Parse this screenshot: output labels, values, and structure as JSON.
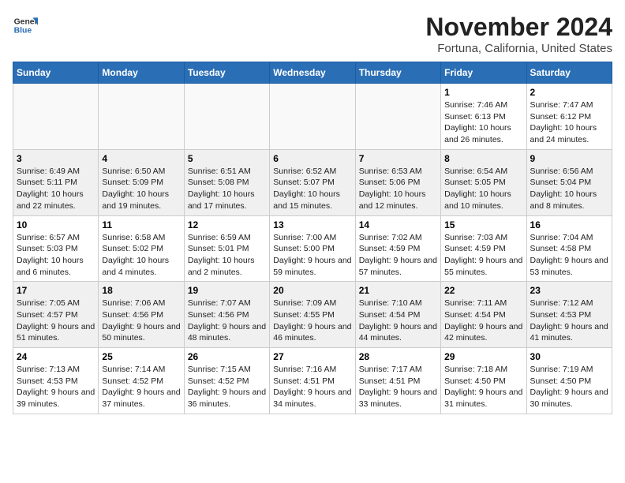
{
  "logo": {
    "general": "General",
    "blue": "Blue"
  },
  "header": {
    "month": "November 2024",
    "location": "Fortuna, California, United States"
  },
  "weekdays": [
    "Sunday",
    "Monday",
    "Tuesday",
    "Wednesday",
    "Thursday",
    "Friday",
    "Saturday"
  ],
  "weeks": [
    [
      {
        "day": "",
        "empty": true
      },
      {
        "day": "",
        "empty": true
      },
      {
        "day": "",
        "empty": true
      },
      {
        "day": "",
        "empty": true
      },
      {
        "day": "",
        "empty": true
      },
      {
        "day": "1",
        "sunrise": "Sunrise: 7:46 AM",
        "sunset": "Sunset: 6:13 PM",
        "daylight": "Daylight: 10 hours and 26 minutes."
      },
      {
        "day": "2",
        "sunrise": "Sunrise: 7:47 AM",
        "sunset": "Sunset: 6:12 PM",
        "daylight": "Daylight: 10 hours and 24 minutes."
      }
    ],
    [
      {
        "day": "3",
        "sunrise": "Sunrise: 6:49 AM",
        "sunset": "Sunset: 5:11 PM",
        "daylight": "Daylight: 10 hours and 22 minutes."
      },
      {
        "day": "4",
        "sunrise": "Sunrise: 6:50 AM",
        "sunset": "Sunset: 5:09 PM",
        "daylight": "Daylight: 10 hours and 19 minutes."
      },
      {
        "day": "5",
        "sunrise": "Sunrise: 6:51 AM",
        "sunset": "Sunset: 5:08 PM",
        "daylight": "Daylight: 10 hours and 17 minutes."
      },
      {
        "day": "6",
        "sunrise": "Sunrise: 6:52 AM",
        "sunset": "Sunset: 5:07 PM",
        "daylight": "Daylight: 10 hours and 15 minutes."
      },
      {
        "day": "7",
        "sunrise": "Sunrise: 6:53 AM",
        "sunset": "Sunset: 5:06 PM",
        "daylight": "Daylight: 10 hours and 12 minutes."
      },
      {
        "day": "8",
        "sunrise": "Sunrise: 6:54 AM",
        "sunset": "Sunset: 5:05 PM",
        "daylight": "Daylight: 10 hours and 10 minutes."
      },
      {
        "day": "9",
        "sunrise": "Sunrise: 6:56 AM",
        "sunset": "Sunset: 5:04 PM",
        "daylight": "Daylight: 10 hours and 8 minutes."
      }
    ],
    [
      {
        "day": "10",
        "sunrise": "Sunrise: 6:57 AM",
        "sunset": "Sunset: 5:03 PM",
        "daylight": "Daylight: 10 hours and 6 minutes."
      },
      {
        "day": "11",
        "sunrise": "Sunrise: 6:58 AM",
        "sunset": "Sunset: 5:02 PM",
        "daylight": "Daylight: 10 hours and 4 minutes."
      },
      {
        "day": "12",
        "sunrise": "Sunrise: 6:59 AM",
        "sunset": "Sunset: 5:01 PM",
        "daylight": "Daylight: 10 hours and 2 minutes."
      },
      {
        "day": "13",
        "sunrise": "Sunrise: 7:00 AM",
        "sunset": "Sunset: 5:00 PM",
        "daylight": "Daylight: 9 hours and 59 minutes."
      },
      {
        "day": "14",
        "sunrise": "Sunrise: 7:02 AM",
        "sunset": "Sunset: 4:59 PM",
        "daylight": "Daylight: 9 hours and 57 minutes."
      },
      {
        "day": "15",
        "sunrise": "Sunrise: 7:03 AM",
        "sunset": "Sunset: 4:59 PM",
        "daylight": "Daylight: 9 hours and 55 minutes."
      },
      {
        "day": "16",
        "sunrise": "Sunrise: 7:04 AM",
        "sunset": "Sunset: 4:58 PM",
        "daylight": "Daylight: 9 hours and 53 minutes."
      }
    ],
    [
      {
        "day": "17",
        "sunrise": "Sunrise: 7:05 AM",
        "sunset": "Sunset: 4:57 PM",
        "daylight": "Daylight: 9 hours and 51 minutes."
      },
      {
        "day": "18",
        "sunrise": "Sunrise: 7:06 AM",
        "sunset": "Sunset: 4:56 PM",
        "daylight": "Daylight: 9 hours and 50 minutes."
      },
      {
        "day": "19",
        "sunrise": "Sunrise: 7:07 AM",
        "sunset": "Sunset: 4:56 PM",
        "daylight": "Daylight: 9 hours and 48 minutes."
      },
      {
        "day": "20",
        "sunrise": "Sunrise: 7:09 AM",
        "sunset": "Sunset: 4:55 PM",
        "daylight": "Daylight: 9 hours and 46 minutes."
      },
      {
        "day": "21",
        "sunrise": "Sunrise: 7:10 AM",
        "sunset": "Sunset: 4:54 PM",
        "daylight": "Daylight: 9 hours and 44 minutes."
      },
      {
        "day": "22",
        "sunrise": "Sunrise: 7:11 AM",
        "sunset": "Sunset: 4:54 PM",
        "daylight": "Daylight: 9 hours and 42 minutes."
      },
      {
        "day": "23",
        "sunrise": "Sunrise: 7:12 AM",
        "sunset": "Sunset: 4:53 PM",
        "daylight": "Daylight: 9 hours and 41 minutes."
      }
    ],
    [
      {
        "day": "24",
        "sunrise": "Sunrise: 7:13 AM",
        "sunset": "Sunset: 4:53 PM",
        "daylight": "Daylight: 9 hours and 39 minutes."
      },
      {
        "day": "25",
        "sunrise": "Sunrise: 7:14 AM",
        "sunset": "Sunset: 4:52 PM",
        "daylight": "Daylight: 9 hours and 37 minutes."
      },
      {
        "day": "26",
        "sunrise": "Sunrise: 7:15 AM",
        "sunset": "Sunset: 4:52 PM",
        "daylight": "Daylight: 9 hours and 36 minutes."
      },
      {
        "day": "27",
        "sunrise": "Sunrise: 7:16 AM",
        "sunset": "Sunset: 4:51 PM",
        "daylight": "Daylight: 9 hours and 34 minutes."
      },
      {
        "day": "28",
        "sunrise": "Sunrise: 7:17 AM",
        "sunset": "Sunset: 4:51 PM",
        "daylight": "Daylight: 9 hours and 33 minutes."
      },
      {
        "day": "29",
        "sunrise": "Sunrise: 7:18 AM",
        "sunset": "Sunset: 4:50 PM",
        "daylight": "Daylight: 9 hours and 31 minutes."
      },
      {
        "day": "30",
        "sunrise": "Sunrise: 7:19 AM",
        "sunset": "Sunset: 4:50 PM",
        "daylight": "Daylight: 9 hours and 30 minutes."
      }
    ]
  ]
}
